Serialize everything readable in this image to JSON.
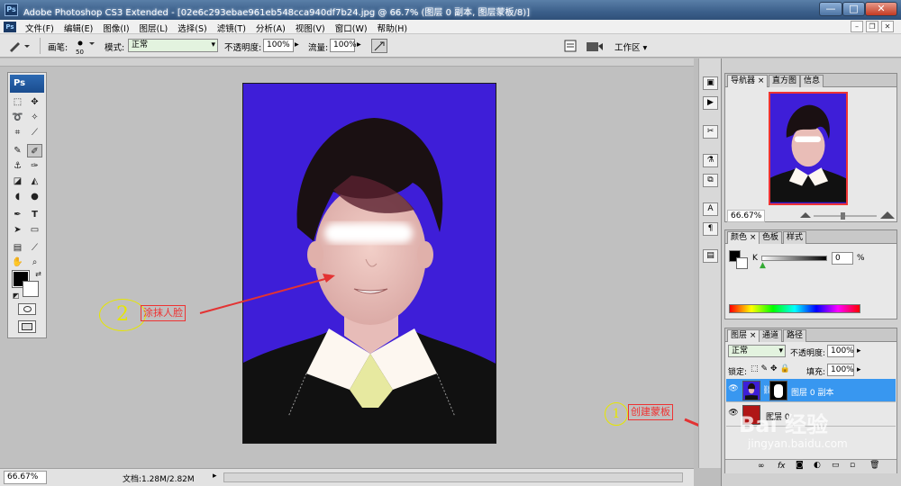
{
  "window": {
    "title": "Adobe Photoshop CS3 Extended - [02e6c293ebae961eb548cca940df7b24.jpg @ 66.7% (图层 0 副本, 图层蒙板/8)]",
    "app_icon": "Ps",
    "minimize": "—",
    "maximize": "□",
    "close": "✕"
  },
  "menu": {
    "items": [
      "文件(F)",
      "编辑(E)",
      "图像(I)",
      "图层(L)",
      "选择(S)",
      "滤镜(T)",
      "分析(A)",
      "视图(V)",
      "窗口(W)",
      "帮助(H)"
    ],
    "mdi_min": "–",
    "mdi_restore": "❐",
    "mdi_close": "✕"
  },
  "options": {
    "brush_label": "画笔:",
    "brush_size": "50",
    "mode_label": "模式:",
    "mode_value": "正常",
    "opacity_label": "不透明度:",
    "opacity_value": "100%",
    "flow_label": "流量:",
    "flow_value": "100%",
    "workspace_label": "工作区 ▾"
  },
  "toolbox": {
    "logo": "Ps"
  },
  "status": {
    "zoom": "66.67%",
    "doc": "文档:1.28M/2.82M"
  },
  "annotations": {
    "smear_label": "涂抹人脸",
    "smear_number": "2",
    "mask_label": "创建蒙板",
    "mask_number": "1"
  },
  "navigator": {
    "tabs": [
      "导航器",
      "直方图",
      "信息"
    ],
    "zoom": "66.67%"
  },
  "color": {
    "tabs": [
      "颜色",
      "色板",
      "样式"
    ],
    "channel": "K",
    "value": "0",
    "unit": "%"
  },
  "layers": {
    "tabs": [
      "图层",
      "通道",
      "路径"
    ],
    "blend_mode": "正常",
    "opacity_label": "不透明度:",
    "opacity_value": "100%",
    "lock_label": "锁定:",
    "fill_label": "填充:",
    "fill_value": "100%",
    "rows": [
      {
        "name": "图层 0 副本",
        "selected": true
      },
      {
        "name": "图层 0",
        "selected": false
      }
    ]
  },
  "watermark": {
    "brand": "Bai 经验",
    "url": "jingyan.baidu.com"
  },
  "colors": {
    "photo_bg": "#3e1ed8",
    "annotation_red": "#e33333",
    "annotation_yellow": "#e6e600",
    "layer_selected": "#3897f0"
  }
}
